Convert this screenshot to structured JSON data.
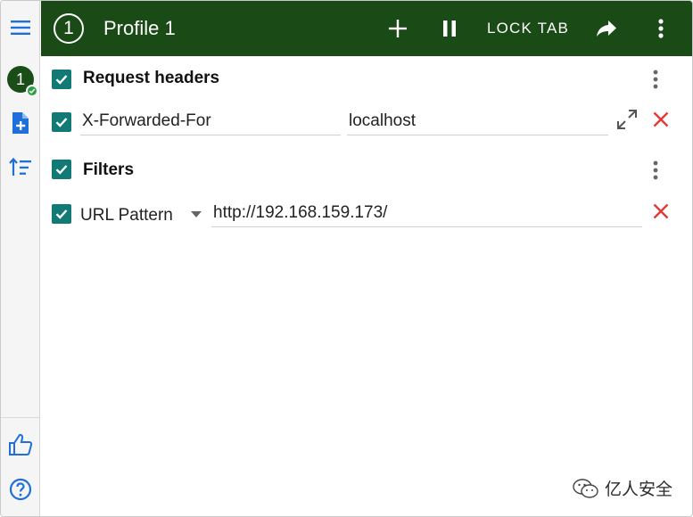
{
  "header": {
    "profile_number": "1",
    "title": "Profile 1",
    "lock_tab_label": "LOCK TAB"
  },
  "sidebar": {
    "profile_badge": "1"
  },
  "request_headers": {
    "section_title": "Request headers",
    "items": [
      {
        "name": "X-Forwarded-For",
        "value": "localhost"
      }
    ]
  },
  "filters": {
    "section_title": "Filters",
    "items": [
      {
        "type": "URL Pattern",
        "value": "http://192.168.159.173/"
      }
    ]
  },
  "watermark": {
    "text": "亿人安全"
  },
  "colors": {
    "header_bg": "#1a4b16",
    "checkbox": "#127a74",
    "delete": "#e53935",
    "sidebar_icon": "#1e6fd9"
  },
  "icons": [
    "menu-icon",
    "add-file-icon",
    "sort-icon",
    "thumbs-up-icon",
    "help-icon",
    "plus-icon",
    "pause-icon",
    "share-icon",
    "more-vert-icon",
    "expand-icon",
    "close-icon",
    "dropdown-arrow-icon"
  ]
}
